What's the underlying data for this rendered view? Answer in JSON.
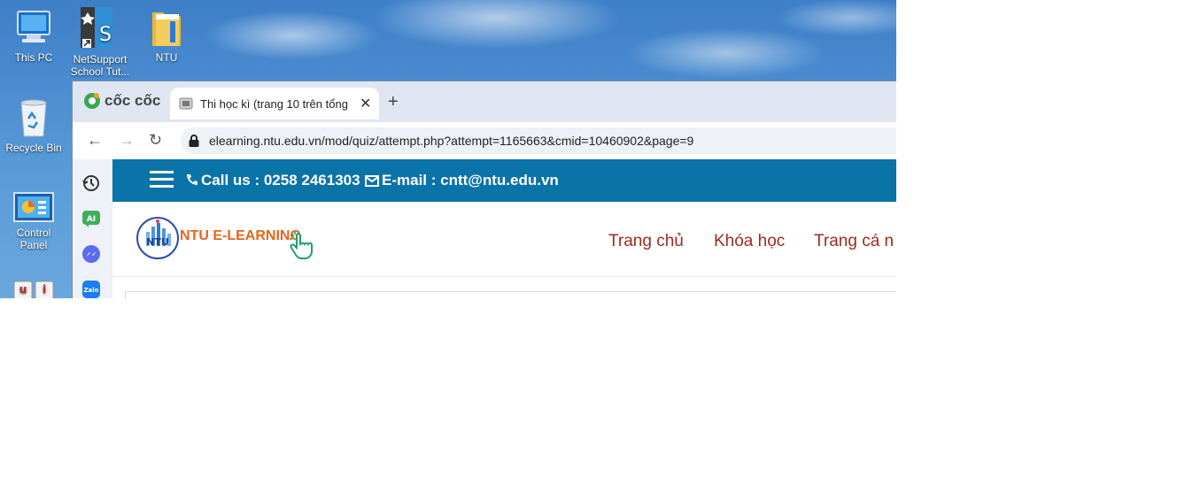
{
  "desktop": {
    "icons": [
      {
        "label": "This PC",
        "icon": "computer-icon"
      },
      {
        "label": "NetSupport School Tut...",
        "icon": "netsupport-icon"
      },
      {
        "label": "NTU",
        "icon": "folder-icon"
      },
      {
        "label": "Recycle Bin",
        "icon": "recycle-bin-icon"
      },
      {
        "label": "Control Panel",
        "icon": "control-panel-icon"
      },
      {
        "label": "",
        "icon": "unikey-icon"
      }
    ]
  },
  "browser": {
    "brand": "cốc cốc",
    "tab_title": "Thi học kì (trang 10 trên tổng",
    "url": "elearning.ntu.edu.vn/mod/quiz/attempt.php?attempt=1165663&cmid=10460902&page=9"
  },
  "site": {
    "call_us": "Call us : 0258 2461303",
    "email": "E-mail : cntt@ntu.edu.vn",
    "logo_text": "NTU E-LEARNING",
    "nav": [
      "Trang chủ",
      "Khóa học",
      "Trang cá n"
    ]
  },
  "colors": {
    "topbar": "#0a73a8",
    "nav_link": "#9e2a1f",
    "logo_text": "#e8651a"
  }
}
